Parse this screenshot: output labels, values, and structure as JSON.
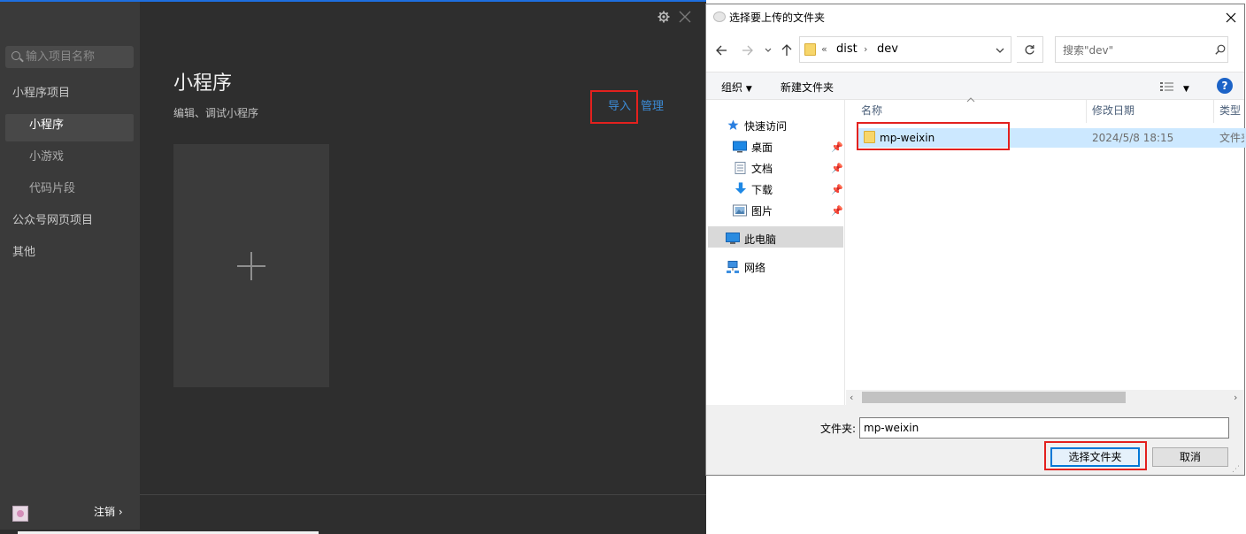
{
  "devtools": {
    "search_placeholder": "输入项目名称",
    "sidebar": {
      "items": [
        {
          "label": "小程序项目"
        },
        {
          "label": "小程序"
        },
        {
          "label": "小游戏"
        },
        {
          "label": "代码片段"
        },
        {
          "label": "公众号网页项目"
        },
        {
          "label": "其他"
        }
      ],
      "active": "小程序"
    },
    "logout_label": "注销",
    "logout_arrow": "›",
    "page_title": "小程序",
    "page_subtitle": "编辑、调试小程序",
    "import_label": "导入",
    "manage_label": "管理",
    "new_card_symbol": "+"
  },
  "dialog": {
    "title": "选择要上传的文件夹",
    "breadcrumb": [
      "dist",
      "dev"
    ],
    "breadcrumb_prefix": "«",
    "search_placeholder": "搜索\"dev\"",
    "toolbar": {
      "organize": "组织",
      "new_folder": "新建文件夹"
    },
    "nav": {
      "quick_access": "快速访问",
      "items": [
        "桌面",
        "文档",
        "下载",
        "图片"
      ],
      "this_pc": "此电脑",
      "network": "网络"
    },
    "columns": {
      "name": "名称",
      "date": "修改日期",
      "type": "类型"
    },
    "rows": [
      {
        "name": "mp-weixin",
        "date": "2024/5/8 18:15",
        "type": "文件夹"
      }
    ],
    "folder_label": "文件夹:",
    "folder_value": "mp-weixin",
    "select_button": "选择文件夹",
    "cancel_button": "取消",
    "help": "?"
  },
  "colors": {
    "accent_link": "#3c8bd6",
    "highlight_box": "#e3211e",
    "selected_row": "#cce8ff"
  }
}
